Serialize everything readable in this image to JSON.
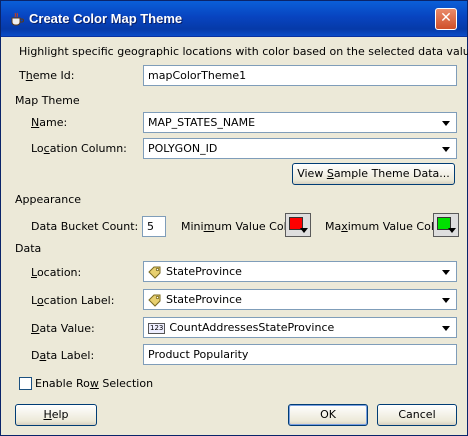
{
  "window": {
    "title": "Create Color Map Theme",
    "close_glyph": "✕"
  },
  "description": "Highlight specific geographic locations with color based on the selected data values.",
  "theme_id": {
    "label_pre": "T",
    "label_ul": "h",
    "label_post": "eme Id:",
    "value": "mapColorTheme1"
  },
  "map_theme": {
    "heading": "Map Theme",
    "name": {
      "label_pre": "",
      "label_ul": "N",
      "label_post": "ame:",
      "value": "MAP_STATES_NAME"
    },
    "location_column": {
      "label_pre": "Lo",
      "label_ul": "c",
      "label_post": "ation Column:",
      "value": "POLYGON_ID"
    },
    "view_button": {
      "pre": "View ",
      "ul": "S",
      "post": "ample Theme Data..."
    }
  },
  "appearance": {
    "heading": "Appearance",
    "bucket_count": {
      "label": "Data Bucket Count:",
      "value": "5"
    },
    "min_color": {
      "label_pre": "Mini",
      "label_ul": "m",
      "label_post": "um Value Color:",
      "color": "#ff0000"
    },
    "max_color": {
      "label_pre": "Ma",
      "label_ul": "x",
      "label_post": "imum Value Color:",
      "color": "#00e000"
    }
  },
  "data": {
    "heading": "Data",
    "location": {
      "label_pre": "",
      "label_ul": "L",
      "label_post": "ocation:",
      "value": "StateProvince",
      "icon": "tag-icon"
    },
    "location_label": {
      "label_pre": "L",
      "label_ul": "o",
      "label_post": "cation Label:",
      "value": "StateProvince",
      "icon": "tag-icon"
    },
    "data_value": {
      "label_pre": "",
      "label_ul": "D",
      "label_post": "ata Value:",
      "value": "CountAddressesStateProvince",
      "icon": "numeric-123-icon",
      "icon_text": "123"
    },
    "data_label": {
      "label_pre": "D",
      "label_ul": "a",
      "label_post": "ta Label:",
      "value": "Product Popularity"
    }
  },
  "enable_row_selection": {
    "label_pre": "Enable Ro",
    "label_ul": "w",
    "label_post": " Selection",
    "checked": false
  },
  "buttons": {
    "help": {
      "ul": "H",
      "post": "elp"
    },
    "ok": "OK",
    "cancel": "Cancel"
  }
}
